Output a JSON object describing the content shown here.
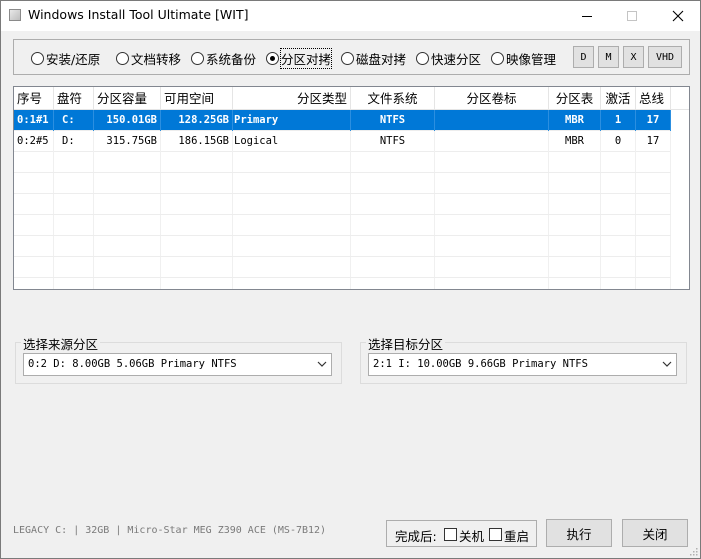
{
  "window": {
    "title": "Windows Install Tool Ultimate [WIT]"
  },
  "modes": {
    "selected_index": 3,
    "items": [
      {
        "label": "安装/还原"
      },
      {
        "label": "文档转移"
      },
      {
        "label": "系统备份"
      },
      {
        "label": "分区对拷"
      },
      {
        "label": "磁盘对拷"
      },
      {
        "label": "快速分区"
      },
      {
        "label": "映像管理"
      }
    ],
    "buttons": [
      {
        "label": "D"
      },
      {
        "label": "M"
      },
      {
        "label": "X"
      },
      {
        "label": "VHD"
      }
    ]
  },
  "table": {
    "columns": [
      "序号",
      "盘符",
      "分区容量",
      "可用空间",
      "分区类型",
      "文件系统",
      "分区卷标",
      "分区表",
      "激活",
      "总线"
    ],
    "rows": [
      {
        "index": "0:1#1",
        "drive": "C:",
        "capacity": "150.01GB",
        "free": "128.25GB",
        "type": "Primary",
        "fs": "NTFS",
        "label": "",
        "table": "MBR",
        "active": "1",
        "bus": "17",
        "selected": true
      },
      {
        "index": "0:2#5",
        "drive": "D:",
        "capacity": "315.75GB",
        "free": "186.15GB",
        "type": "Logical",
        "fs": "NTFS",
        "label": "",
        "table": "MBR",
        "active": "0",
        "bus": "17",
        "selected": false
      }
    ]
  },
  "source": {
    "title": "选择来源分区",
    "value": "0:2  D: 8.00GB 5.06GB Primary NTFS"
  },
  "target": {
    "title": "选择目标分区",
    "value": "2:1  I:  10.00GB 9.66GB Primary NTFS"
  },
  "status": {
    "text": "LEGACY C:  | 32GB | Micro-Star MEG Z390 ACE (MS-7B12)"
  },
  "after": {
    "label": "完成后:",
    "shutdown": "关机",
    "restart": "重启"
  },
  "actions": {
    "execute": "执行",
    "close": "关闭"
  },
  "colors": {
    "selection": "#0078d7",
    "background": "#f0f0f0"
  }
}
